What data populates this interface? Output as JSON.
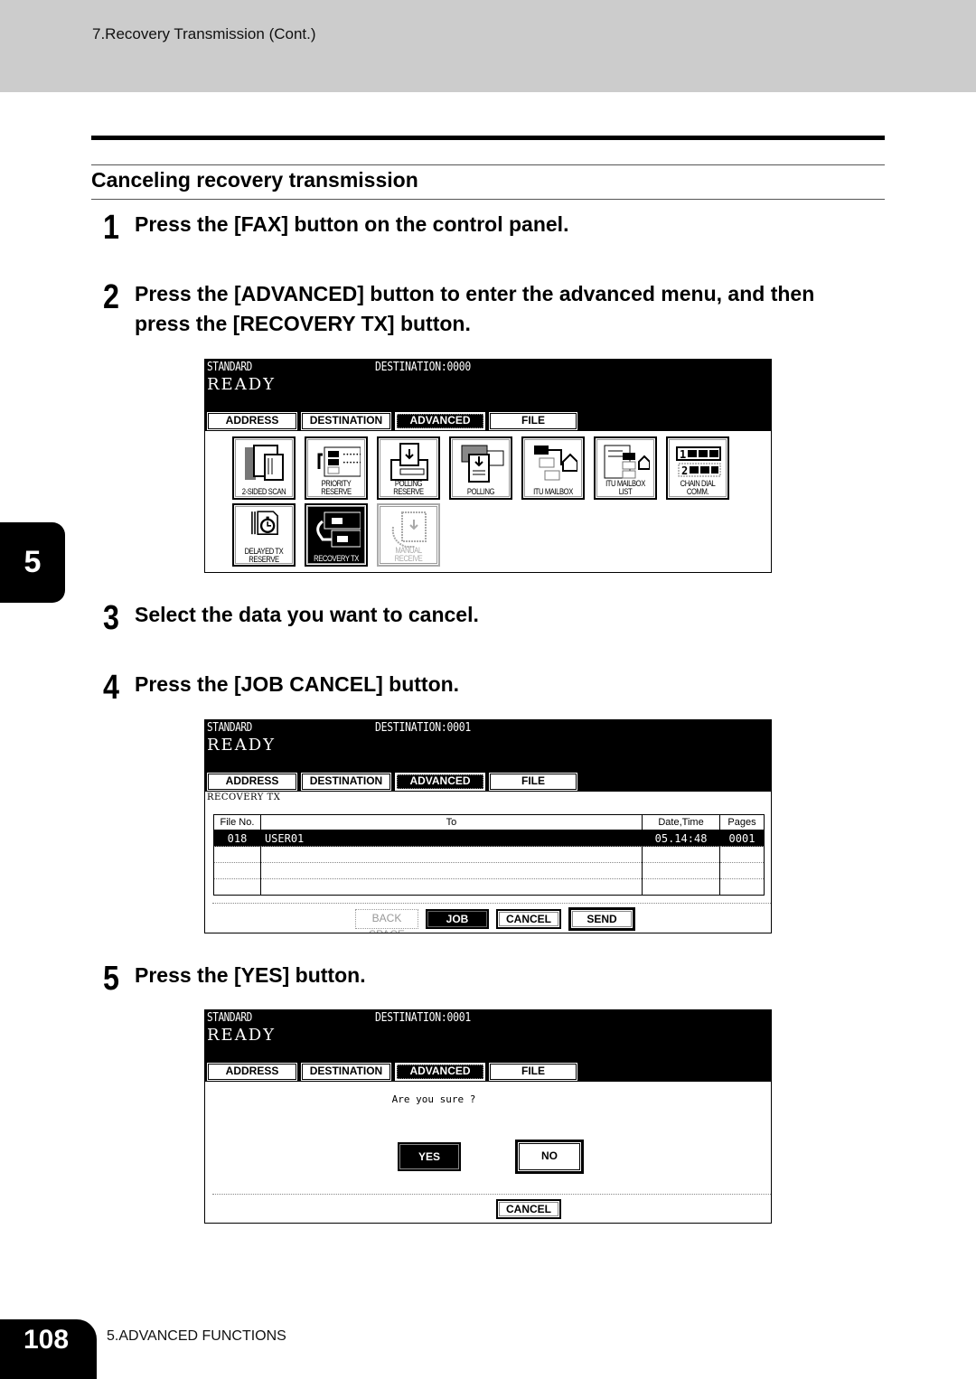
{
  "header": {
    "running_head": "7.Recovery Transmission (Cont.)"
  },
  "section": {
    "title": "Canceling recovery transmission"
  },
  "steps": [
    {
      "num": "1",
      "text": "Press the [FAX] button on the control panel."
    },
    {
      "num": "2",
      "text_line1": "Press the [ADVANCED] button to enter the advanced menu, and then",
      "text_line2": "press the [RECOVERY TX] button."
    },
    {
      "num": "3",
      "text": "Select the data you want to cancel."
    },
    {
      "num": "4",
      "text": "Press the [JOB CANCEL] button."
    },
    {
      "num": "5",
      "text": "Press the [YES] button."
    }
  ],
  "screen1": {
    "mode": "STANDARD",
    "destination": "DESTINATION:0000",
    "status": "READY",
    "tabs": [
      "ADDRESS",
      "DESTINATION",
      "ADVANCED",
      "FILE"
    ],
    "active_tab": "ADVANCED",
    "icons": [
      {
        "label": "2-SIDED SCAN",
        "icon": "two-sided-scan-icon",
        "state": "normal"
      },
      {
        "label": "PRIORITY RESERVE",
        "icon": "priority-reserve-icon",
        "state": "normal"
      },
      {
        "label": "POLLING RESERVE",
        "icon": "polling-reserve-icon",
        "state": "normal"
      },
      {
        "label": "POLLING",
        "icon": "polling-icon",
        "state": "normal"
      },
      {
        "label": "ITU MAILBOX",
        "icon": "itu-mailbox-icon",
        "state": "normal"
      },
      {
        "label": "ITU MAILBOX LIST",
        "icon": "itu-mailbox-list-icon",
        "state": "normal"
      },
      {
        "label": "CHAIN DIAL COMM.",
        "icon": "chain-dial-icon",
        "state": "normal"
      },
      {
        "label_line1": "DELAYED TX",
        "label_line2": "RESERVE",
        "icon": "delayed-tx-icon",
        "state": "normal"
      },
      {
        "label": "RECOVERY TX",
        "icon": "recovery-tx-icon",
        "state": "selected"
      },
      {
        "label": "MANUAL RECEIVE",
        "icon": "manual-receive-icon",
        "state": "disabled"
      }
    ]
  },
  "screen2": {
    "mode": "STANDARD",
    "destination": "DESTINATION:0001",
    "status": "READY",
    "tabs": [
      "ADDRESS",
      "DESTINATION",
      "ADVANCED",
      "FILE"
    ],
    "active_tab": "ADVANCED",
    "section_label": "RECOVERY TX",
    "table": {
      "columns": [
        "File No.",
        "To",
        "Date,Time",
        "Pages"
      ],
      "rows": [
        {
          "file_no": "018",
          "to": "USER01",
          "date_time": "05.14:48",
          "pages": "0001",
          "selected": true
        },
        {
          "file_no": "",
          "to": "",
          "date_time": "",
          "pages": ""
        },
        {
          "file_no": "",
          "to": "",
          "date_time": "",
          "pages": ""
        },
        {
          "file_no": "",
          "to": "",
          "date_time": "",
          "pages": ""
        }
      ]
    },
    "buttons": {
      "back_space": "BACK SPACE",
      "job_cancel": "JOB CANCEL",
      "cancel": "CANCEL",
      "send": "SEND"
    }
  },
  "screen3": {
    "mode": "STANDARD",
    "destination": "DESTINATION:0001",
    "status": "READY",
    "tabs": [
      "ADDRESS",
      "DESTINATION",
      "ADVANCED",
      "FILE"
    ],
    "active_tab": "ADVANCED",
    "prompt": "Are you sure ?",
    "buttons": {
      "yes": "YES",
      "no": "NO",
      "cancel": "CANCEL"
    }
  },
  "chapter_tab": "5",
  "footer": {
    "page_number": "108",
    "chapter_label": "5.ADVANCED FUNCTIONS"
  }
}
